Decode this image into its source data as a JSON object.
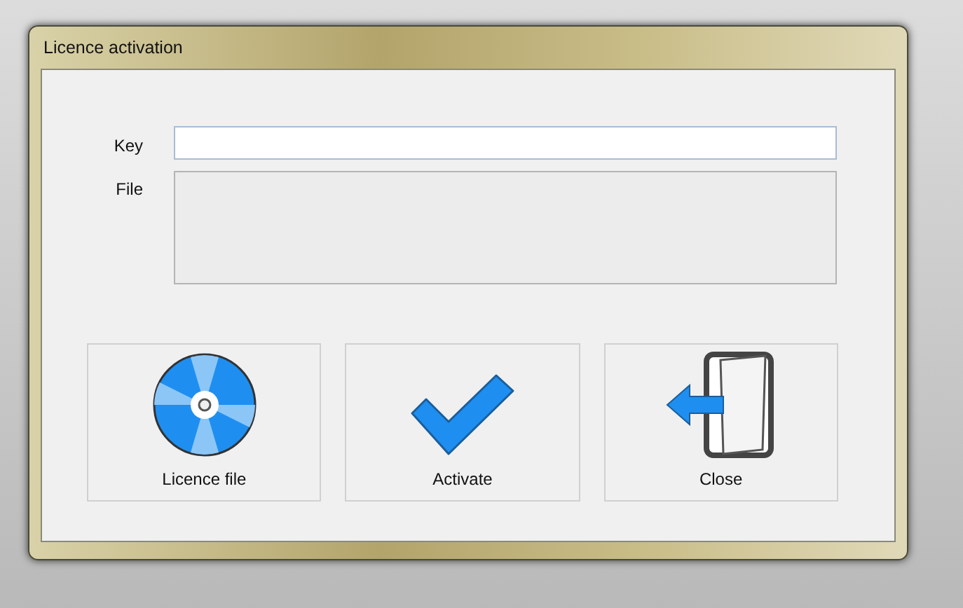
{
  "window": {
    "title": "Licence activation"
  },
  "fields": [
    {
      "label": "Key",
      "kind": "line"
    },
    {
      "label": "File",
      "kind": "area"
    }
  ],
  "buttons": [
    {
      "label": "Licence file",
      "kind": "disc"
    },
    {
      "label": "Activate",
      "kind": "check"
    },
    {
      "label": "Close",
      "kind": "exit"
    }
  ]
}
